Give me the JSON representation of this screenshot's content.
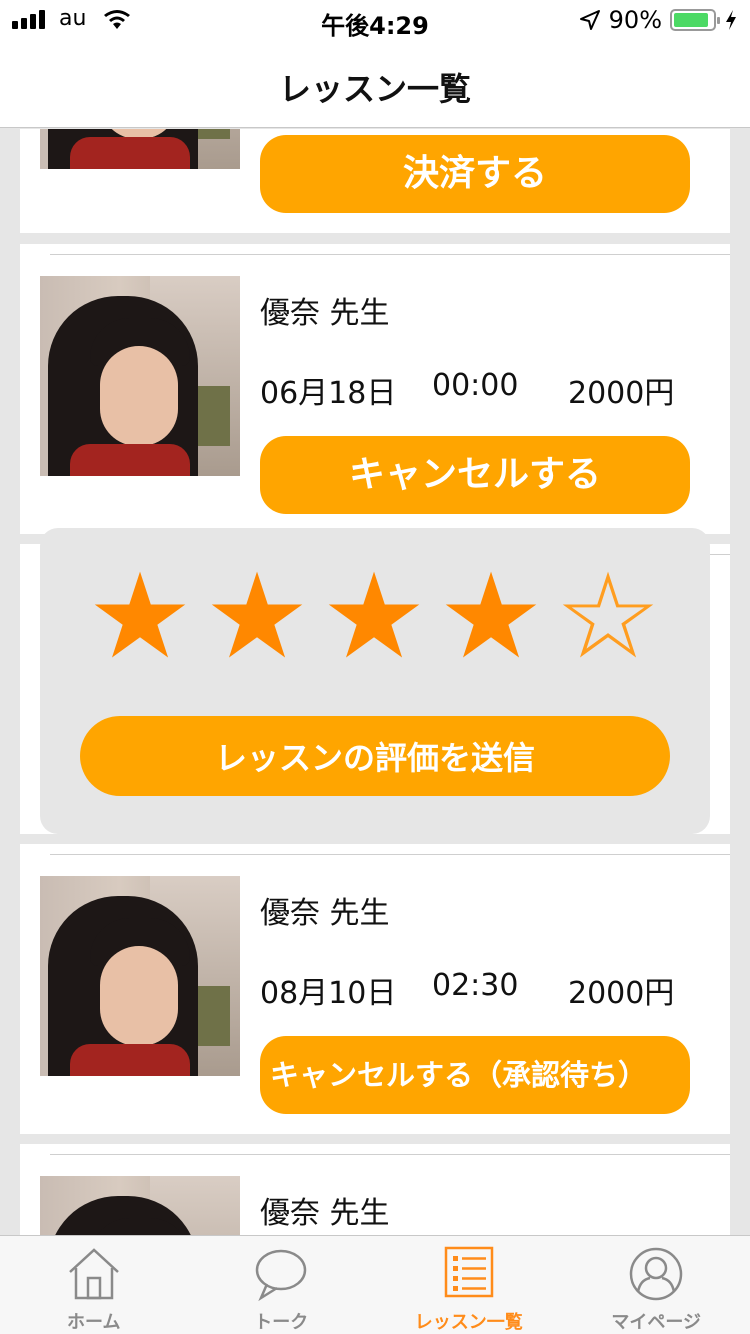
{
  "status_bar": {
    "carrier": "au",
    "time": "午後4:29",
    "battery": "90%",
    "battery_level": 0.9,
    "colors": {
      "battery_fill": "#4cd964"
    }
  },
  "nav": {
    "title": "レッスン一覧"
  },
  "lessons": [
    {
      "button_label": "決済する"
    },
    {
      "teacher": "優奈 先生",
      "date": "06月18日",
      "time": "00:00",
      "price": "2000円",
      "button_label": "キャンセルする"
    },
    {
      "teacher": "",
      "date": "",
      "time": "",
      "price": ""
    },
    {
      "teacher": "優奈 先生",
      "date": "08月10日",
      "time": "02:30",
      "price": "2000円",
      "button_label": "キャンセルする（承認待ち）"
    },
    {
      "teacher": "優奈 先生"
    }
  ],
  "rating_popup": {
    "rating": 4,
    "max_rating": 5,
    "submit_label": "レッスンの評価を送信",
    "star_filled": "★",
    "star_empty": "☆"
  },
  "tabbar": {
    "items": [
      {
        "label": "ホーム",
        "icon": "home-icon"
      },
      {
        "label": "トーク",
        "icon": "speech-bubble-icon"
      },
      {
        "label": "レッスン一覧",
        "icon": "list-icon",
        "active": true
      },
      {
        "label": "マイページ",
        "icon": "profile-icon"
      }
    ]
  },
  "colors": {
    "accent": "#ffa500",
    "star": "#ff8800",
    "active_tab": "#ff8c1a"
  }
}
